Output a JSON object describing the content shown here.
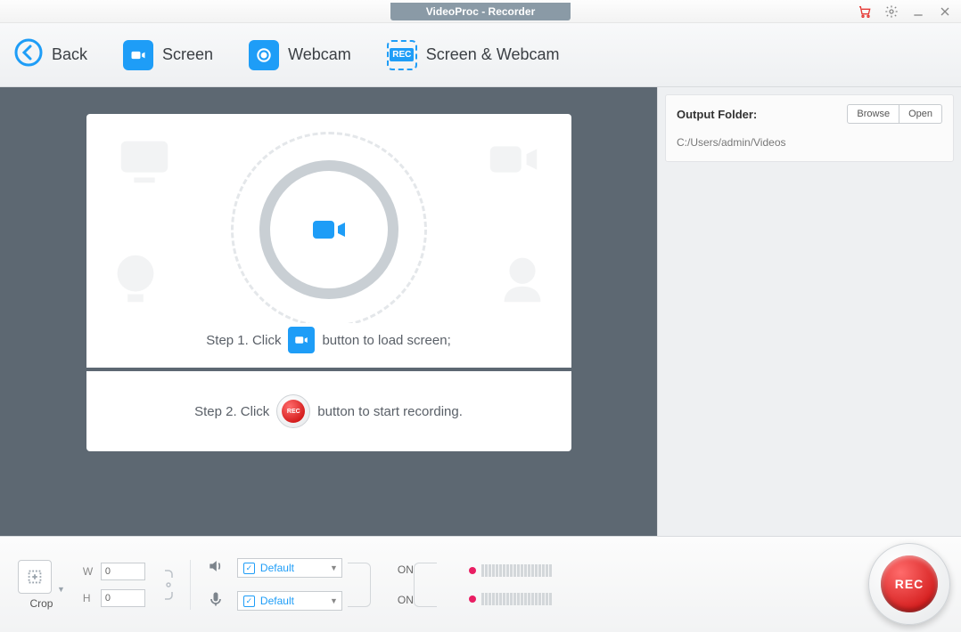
{
  "title": "VideoProc - Recorder",
  "toolbar": {
    "back": "Back",
    "screen": "Screen",
    "webcam": "Webcam",
    "screen_webcam": "Screen & Webcam",
    "rec_badge": "REC"
  },
  "stage": {
    "step1_pre": "Step 1. Click",
    "step1_post": "button to load screen;",
    "step2_pre": "Step 2. Click",
    "step2_post": "button to start recording.",
    "rec_mini": "REC"
  },
  "side": {
    "output_folder_label": "Output Folder:",
    "browse": "Browse",
    "open": "Open",
    "path": "C:/Users/admin/Videos"
  },
  "bottom": {
    "crop": "Crop",
    "w_label": "W",
    "h_label": "H",
    "w_value": "0",
    "h_value": "0",
    "audio_spk": "Default",
    "audio_mic": "Default",
    "on_spk": "ON",
    "on_mic": "ON",
    "rec": "REC"
  }
}
